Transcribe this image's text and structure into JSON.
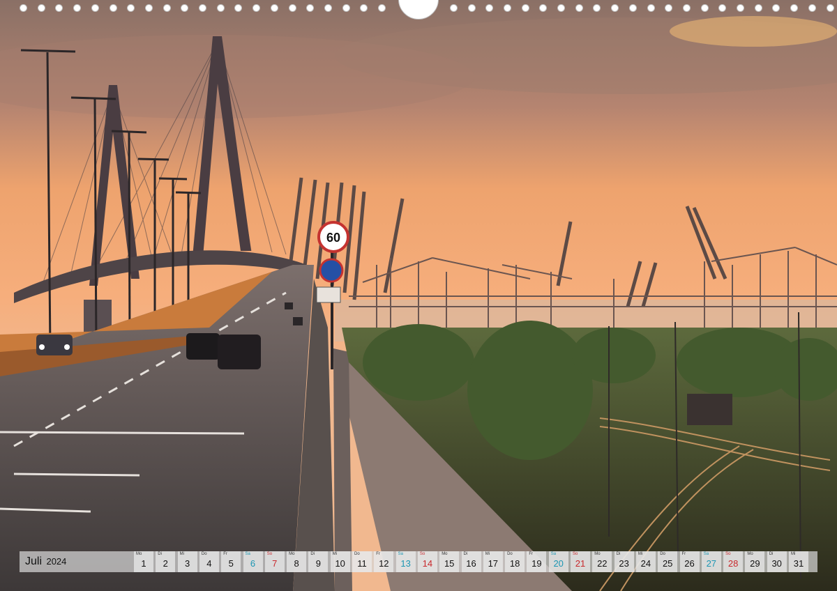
{
  "calendar": {
    "month": "Juli",
    "year": "2024",
    "colors": {
      "saturday": "#1c96b3",
      "sunday": "#c8282c",
      "weekday": "#111111"
    },
    "days": [
      {
        "wd": "Mo",
        "d": "1"
      },
      {
        "wd": "Di",
        "d": "2"
      },
      {
        "wd": "Mi",
        "d": "3"
      },
      {
        "wd": "Do",
        "d": "4"
      },
      {
        "wd": "Fr",
        "d": "5"
      },
      {
        "wd": "Sa",
        "d": "6"
      },
      {
        "wd": "So",
        "d": "7"
      },
      {
        "wd": "Mo",
        "d": "8"
      },
      {
        "wd": "Di",
        "d": "9"
      },
      {
        "wd": "Mi",
        "d": "10"
      },
      {
        "wd": "Do",
        "d": "11"
      },
      {
        "wd": "Fr",
        "d": "12"
      },
      {
        "wd": "Sa",
        "d": "13"
      },
      {
        "wd": "So",
        "d": "14"
      },
      {
        "wd": "Mo",
        "d": "15"
      },
      {
        "wd": "Di",
        "d": "16"
      },
      {
        "wd": "Mi",
        "d": "17"
      },
      {
        "wd": "Do",
        "d": "18"
      },
      {
        "wd": "Fr",
        "d": "19"
      },
      {
        "wd": "Sa",
        "d": "20"
      },
      {
        "wd": "So",
        "d": "21"
      },
      {
        "wd": "Mo",
        "d": "22"
      },
      {
        "wd": "Di",
        "d": "23"
      },
      {
        "wd": "Mi",
        "d": "24"
      },
      {
        "wd": "Do",
        "d": "25"
      },
      {
        "wd": "Fr",
        "d": "26"
      },
      {
        "wd": "Sa",
        "d": "27"
      },
      {
        "wd": "So",
        "d": "28"
      },
      {
        "wd": "Mo",
        "d": "29"
      },
      {
        "wd": "Di",
        "d": "30"
      },
      {
        "wd": "Mi",
        "d": "31"
      }
    ]
  },
  "photo": {
    "speed_sign": "60"
  }
}
